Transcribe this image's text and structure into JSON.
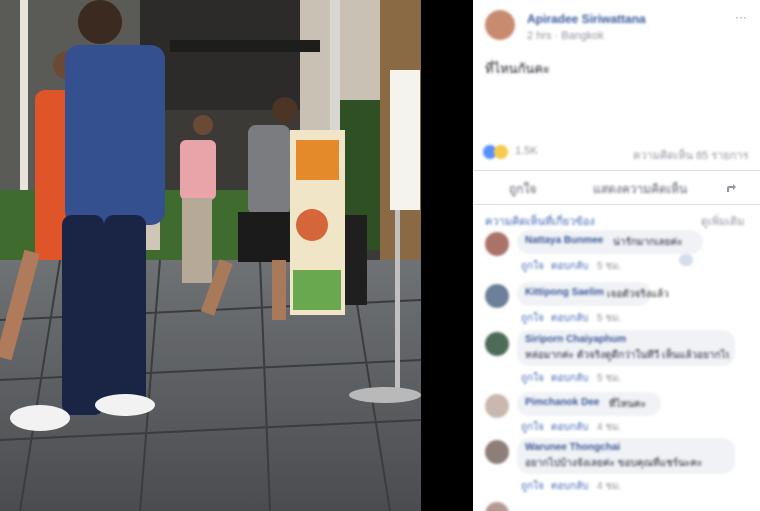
{
  "post": {
    "author": "Apiradee Siriwattana",
    "meta": "2 hrs · Bangkok",
    "more": "···",
    "caption": "ที่ไหนกันคะ",
    "reactions_count": "1.5K",
    "comments_shares": "ความคิดเห็น 85 รายการ",
    "like_label": "ถูกใจ",
    "comment_label": "แสดงความคิดเห็น",
    "share_icon": "share-icon",
    "accent": "#4267b2"
  },
  "comments": {
    "header_left": "ความคิดเห็นที่เกี่ยวข้อง",
    "header_right": "ดูเพิ่มเติม",
    "items": [
      {
        "name": "Nattaya Bunmee",
        "text": "น่ารักมากเลยค่ะ",
        "like": "ถูกใจ",
        "reply": "ตอบกลับ",
        "time": "5 ชม."
      },
      {
        "name": "Kittipong Saelim",
        "text": "เจอตัวจริงแล้ว",
        "like": "ถูกใจ",
        "reply": "ตอบกลับ",
        "time": "5 ชม."
      },
      {
        "name": "Siriporn Chaiyaphum",
        "text": "หล่อมากค่ะ ตัวจริงดูดีกว่าในทีวี เห็นแล้วอยากไปเที่ยว",
        "like": "ถูกใจ",
        "reply": "ตอบกลับ",
        "time": "5 ชม."
      },
      {
        "name": "Pimchanok Dee",
        "text": "ที่ไหนคะ",
        "like": "ถูกใจ",
        "reply": "ตอบกลับ",
        "time": "4 ชม."
      },
      {
        "name": "Warunee Thongchai",
        "text": "อยากไปบ้างจังเลยค่ะ ขอบคุณที่แชร์นะคะ",
        "like": "ถูกใจ",
        "reply": "ตอบกลับ",
        "time": "4 ชม."
      }
    ]
  }
}
